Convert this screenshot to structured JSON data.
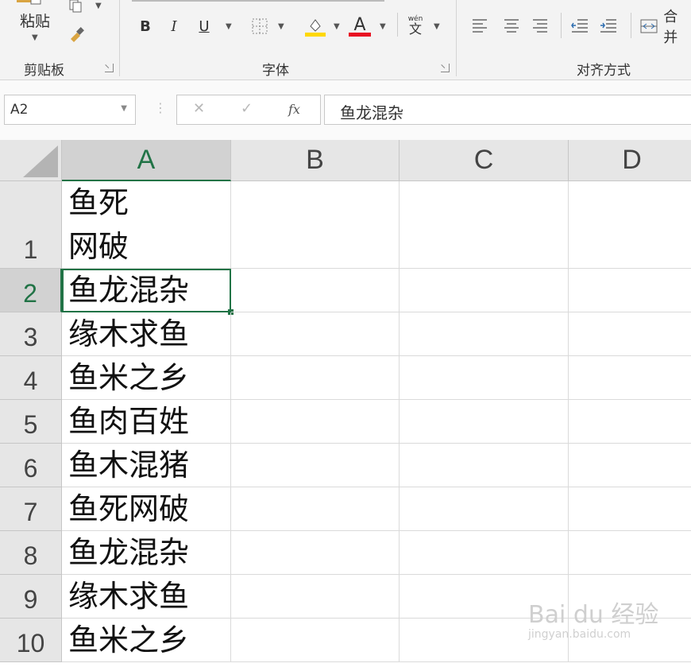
{
  "ribbon": {
    "clipboard": {
      "paste_label": "粘贴",
      "group_label": "剪贴板"
    },
    "font": {
      "group_label": "字体",
      "bold": "B",
      "italic": "I",
      "underline": "U",
      "font_color_glyph": "A",
      "phonetic_glyph": "wén",
      "phonetic_sub": "文",
      "fill_color": "#ffd800",
      "font_color": "#e81123"
    },
    "alignment": {
      "group_label": "对齐方式",
      "merge_label": "合并"
    }
  },
  "formula_bar": {
    "name_box": "A2",
    "fx_label": "fx",
    "cancel_glyph": "✕",
    "enter_glyph": "✓",
    "value": "鱼龙混杂"
  },
  "sheet": {
    "columns": [
      "A",
      "B",
      "C",
      "D"
    ],
    "selected_column": "A",
    "selected_row": "2",
    "rows": [
      {
        "num": "1",
        "a": "鱼死\n网破"
      },
      {
        "num": "2",
        "a": "鱼龙混杂"
      },
      {
        "num": "3",
        "a": "缘木求鱼"
      },
      {
        "num": "4",
        "a": "鱼米之乡"
      },
      {
        "num": "5",
        "a": "鱼肉百姓"
      },
      {
        "num": "6",
        "a": "鱼木混猪"
      },
      {
        "num": "7",
        "a": "鱼死网破"
      },
      {
        "num": "8",
        "a": "鱼龙混杂"
      },
      {
        "num": "9",
        "a": "缘木求鱼"
      },
      {
        "num": "10",
        "a": "鱼米之乡"
      }
    ]
  },
  "watermark": {
    "brand": "Bai du 经验",
    "url": "jingyan.baidu.com"
  }
}
